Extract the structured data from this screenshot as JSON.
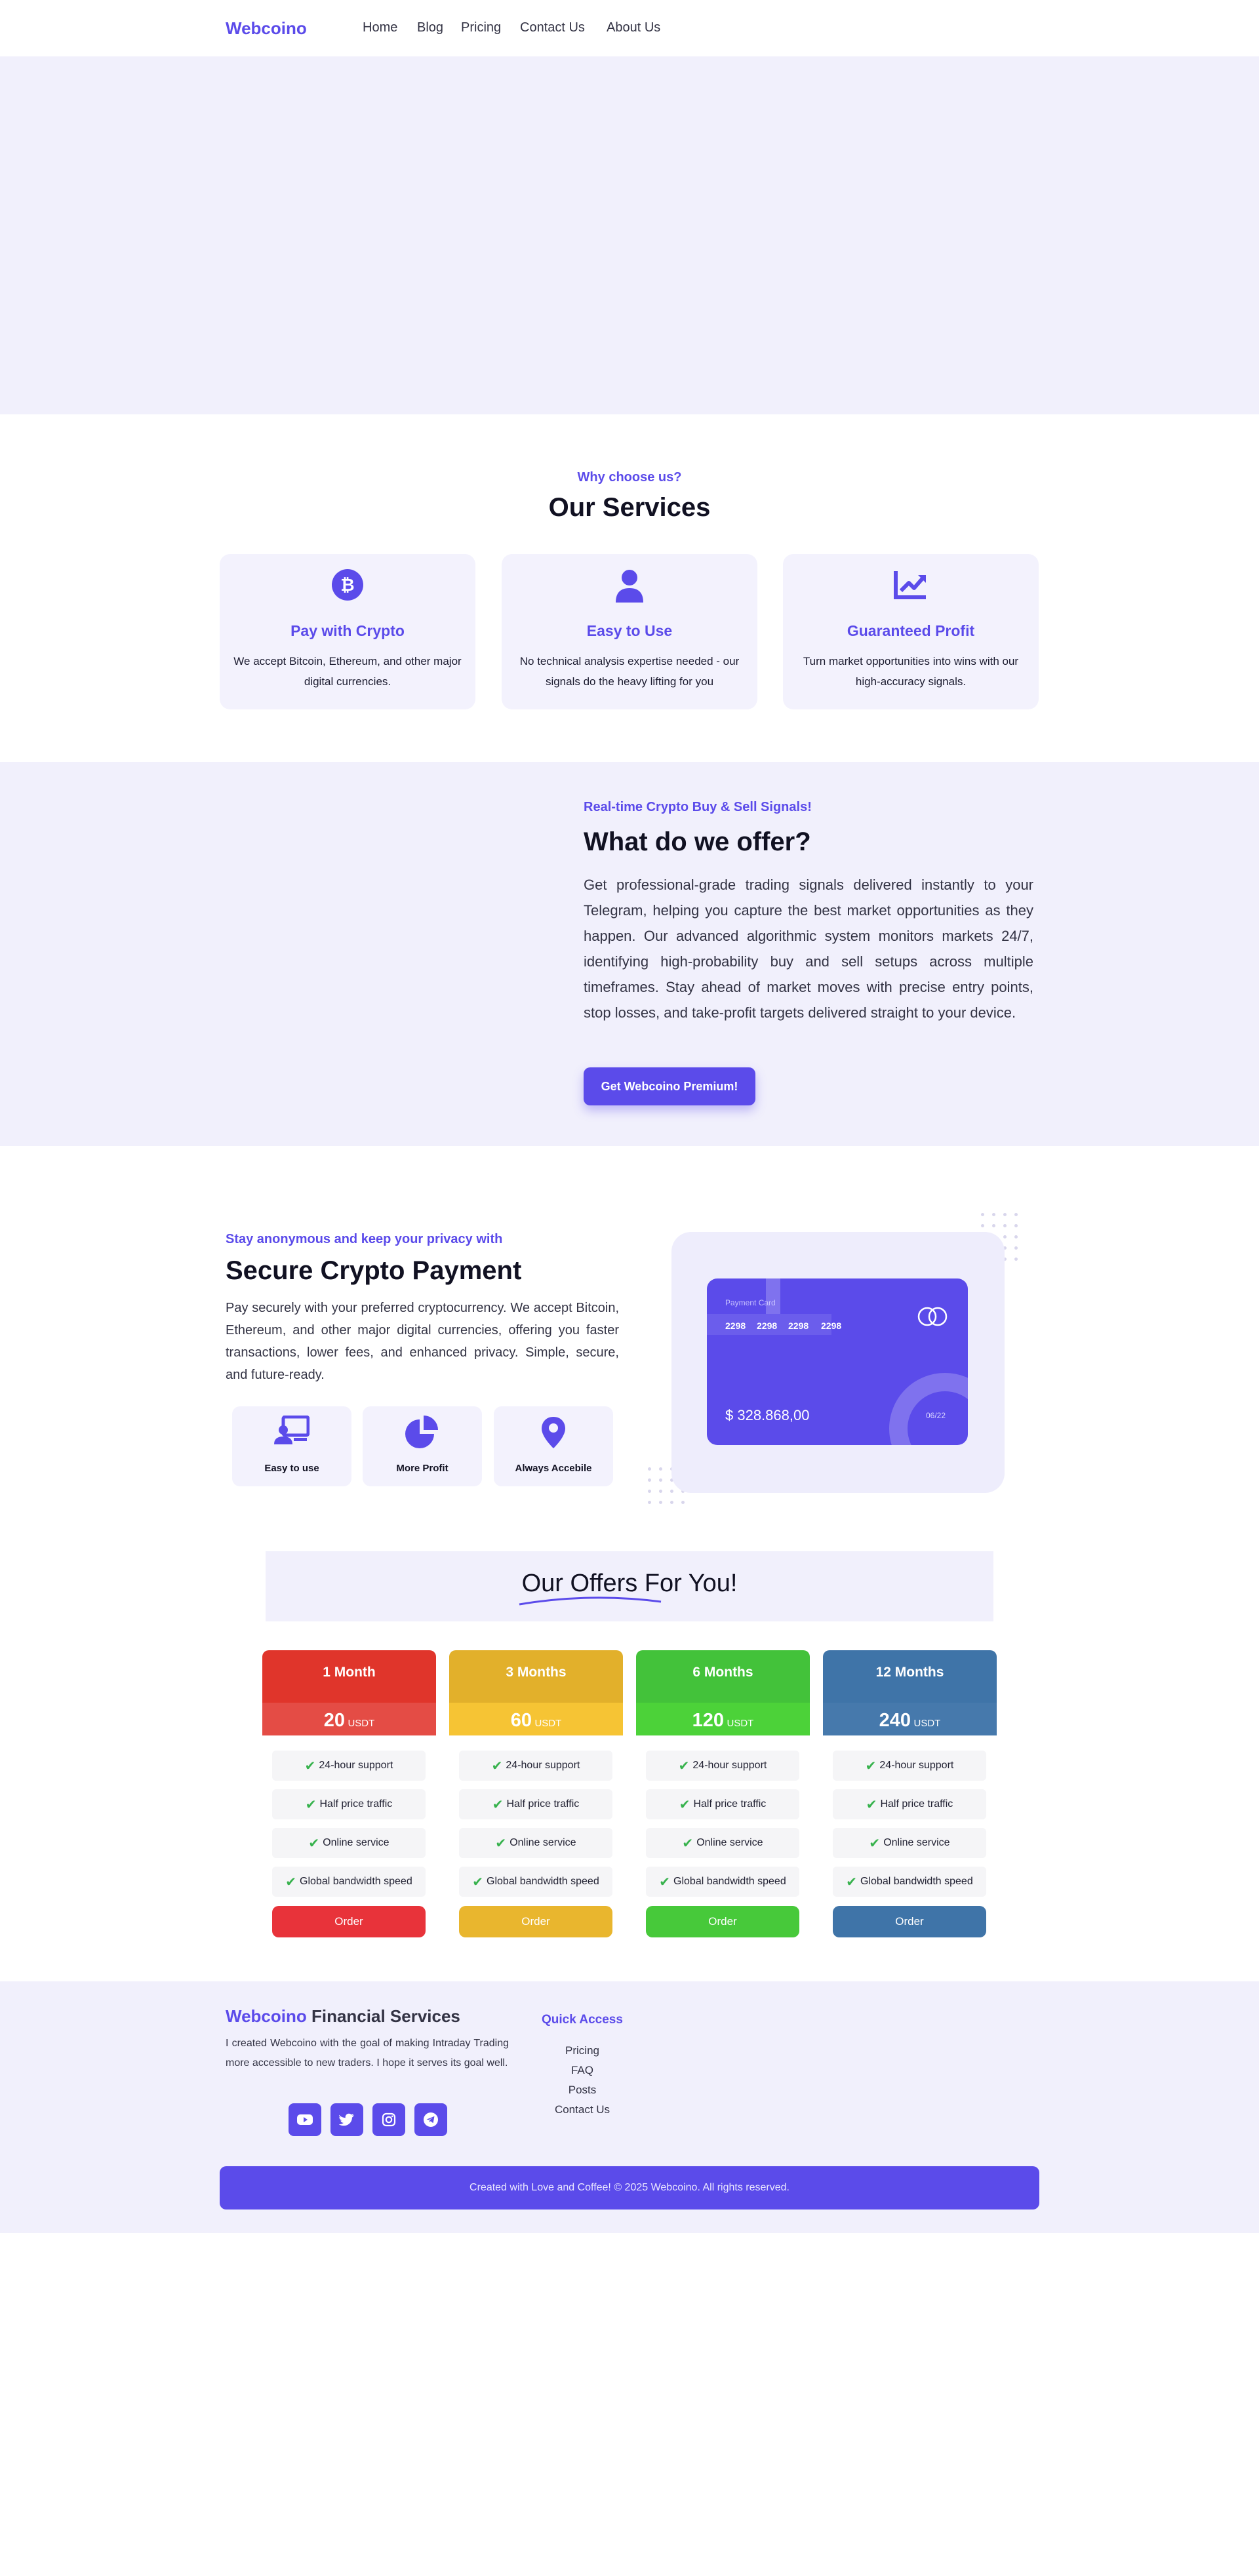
{
  "nav": {
    "brand": "Webcoino",
    "links": [
      "Home",
      "Blog",
      "Pricing",
      "Contact Us",
      "About Us"
    ]
  },
  "services": {
    "eyebrow": "Why choose us?",
    "title": "Our Services",
    "cards": [
      {
        "icon": "bitcoin-icon",
        "title": "Pay with Crypto",
        "desc": "We accept Bitcoin, Ethereum, and other major digital currencies."
      },
      {
        "icon": "user-icon",
        "title": "Easy to Use",
        "desc": "No technical analysis expertise needed - our signals do the heavy lifting for you"
      },
      {
        "icon": "chart-line-icon",
        "title": "Guaranteed Profit",
        "desc": "Turn market opportunities into wins with our high-accuracy signals."
      }
    ]
  },
  "offer": {
    "eyebrow": "Real-time Crypto Buy & Sell Signals!",
    "title": "What do we offer?",
    "desc": "Get professional-grade trading signals delivered instantly to your Telegram, helping you capture the best market opportunities as they happen. Our advanced algorithmic system monitors markets 24/7, identifying high-probability buy and sell setups across multiple timeframes. Stay ahead of market moves with precise entry points, stop losses, and take-profit targets delivered straight to your device.",
    "button": "Get Webcoino Premium!"
  },
  "secure": {
    "eyebrow": "Stay anonymous and keep your privacy with",
    "title": "Secure Crypto Payment",
    "desc": "Pay securely with your preferred cryptocurrency. We accept Bitcoin, Ethereum, and other major digital currencies, offering you faster transactions, lower fees, and enhanced privacy. Simple, secure, and future-ready.",
    "features": [
      {
        "icon": "desktop-user-icon",
        "label": "Easy to use"
      },
      {
        "icon": "pie-chart-icon",
        "label": "More Profit"
      },
      {
        "icon": "location-pin-icon",
        "label": "Always Accebile"
      }
    ],
    "card": {
      "label": "Payment Card",
      "number": [
        "2298",
        "2298",
        "2298",
        "2298"
      ],
      "balance": "$ 328.868,00",
      "expiry": "06/22"
    }
  },
  "pricing": {
    "title_part1": "Our Offers",
    "title_part2": " For You!",
    "plans": [
      {
        "name": "1 Month",
        "price": "20",
        "currency": "USDT",
        "color": "#e0352b",
        "band": "#e44c45",
        "order_color": "#e8333a"
      },
      {
        "name": "3 Months",
        "price": "60",
        "currency": "USDT",
        "color": "#e2b02b",
        "band": "#f6c434",
        "order_color": "#e9b62e"
      },
      {
        "name": "6 Months",
        "price": "120",
        "currency": "USDT",
        "color": "#43c23a",
        "band": "#4cd239",
        "order_color": "#47c93a"
      },
      {
        "name": "12 Months",
        "price": "240",
        "currency": "USDT",
        "color": "#3f74a8",
        "band": "#4679ac",
        "order_color": "#3f74a8"
      }
    ],
    "features": [
      "24-hour support",
      "Half price traffic",
      "Online service",
      "Global bandwidth speed"
    ],
    "order_label": "Order"
  },
  "footer": {
    "brand": "Webcoino",
    "brand_suffix": " Financial Services",
    "desc": "I created Webcoino with the goal of making Intraday Trading more accessible to new traders. I hope it serves its goal well.",
    "social": [
      "youtube-icon",
      "twitter-icon",
      "instagram-icon",
      "telegram-icon"
    ],
    "quick_access_title": "Quick Access",
    "quick_links": [
      "Pricing",
      "FAQ",
      "Posts",
      "Contact Us"
    ],
    "copyright": "Created with Love and Coffee! © 2025 Webcoino. All rights reserved."
  }
}
